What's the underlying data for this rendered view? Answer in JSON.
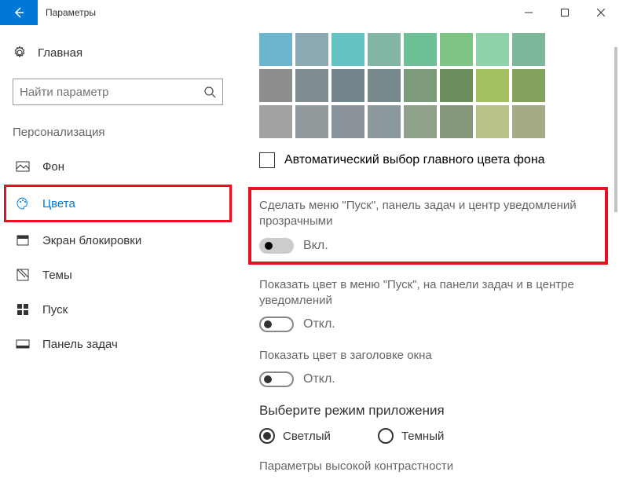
{
  "window": {
    "title": "Параметры"
  },
  "sidebar": {
    "home": "Главная",
    "search_placeholder": "Найти параметр",
    "section": "Персонализация",
    "items": [
      {
        "label": "Фон"
      },
      {
        "label": "Цвета"
      },
      {
        "label": "Экран блокировки"
      },
      {
        "label": "Темы"
      },
      {
        "label": "Пуск"
      },
      {
        "label": "Панель задач"
      }
    ]
  },
  "content": {
    "swatches": [
      "#6bb6cc",
      "#8aa9b2",
      "#64c3c3",
      "#82b5a3",
      "#6ec196",
      "#7fc586",
      "#8fd4a8",
      "#7fb79a",
      "#8d8d8d",
      "#7e8b8f",
      "#75858c",
      "#78898c",
      "#7d9a7a",
      "#6b8e5d",
      "#a4c060",
      "#83a25c",
      "#a2a2a2",
      "#939a9e",
      "#899399",
      "#8b989c",
      "#8fa08b",
      "#87987a",
      "#b7c38a",
      "#a3ab87"
    ],
    "auto_color": "Автоматический выбор главного цвета фона",
    "transparency": {
      "title": "Сделать меню \"Пуск\", панель задач и центр уведомлений прозрачными",
      "state_label": "Вкл."
    },
    "show_color_start": {
      "title": "Показать цвет в меню \"Пуск\", на панели задач и в центре уведомлений",
      "state_label": "Откл."
    },
    "show_color_titlebar": {
      "title": "Показать цвет в заголовке окна",
      "state_label": "Откл."
    },
    "app_mode": {
      "title": "Выберите режим приложения",
      "light": "Светлый",
      "dark": "Темный"
    },
    "high_contrast": "Параметры высокой контрастности"
  }
}
